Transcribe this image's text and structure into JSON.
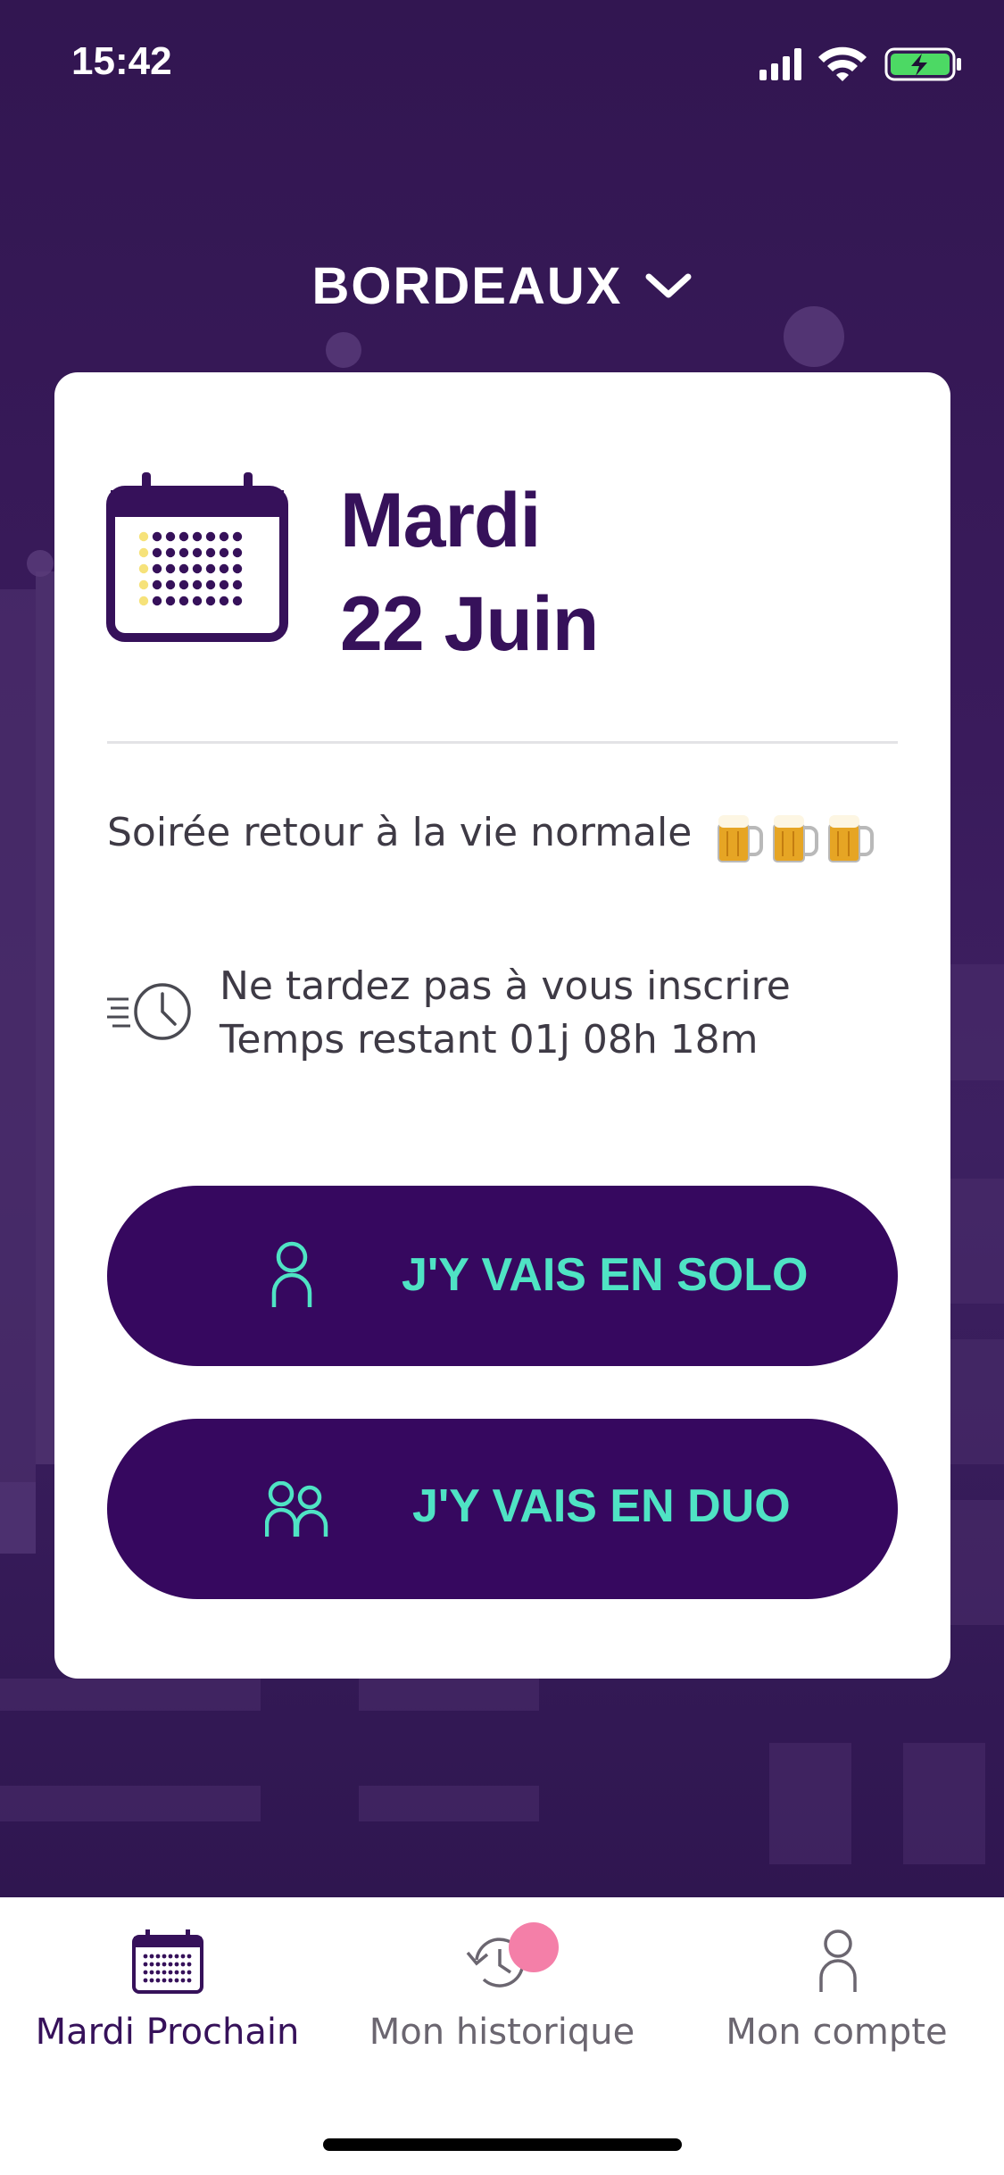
{
  "status_bar": {
    "time": "15:42"
  },
  "header": {
    "city": "BORDEAUX"
  },
  "card": {
    "day": "Mardi",
    "date": "22 Juin",
    "event_title": "Soirée retour à la vie normale",
    "event_emoji": "beer-mugs",
    "deadline_line1": "Ne tardez pas à vous inscrire",
    "deadline_line2": "Temps restant  01j 08h 18m",
    "solo_button": "J'Y VAIS EN SOLO",
    "duo_button": "J'Y VAIS EN DUO"
  },
  "nav": {
    "items": [
      {
        "label": "Mardi Prochain",
        "icon": "calendar-icon",
        "active": true
      },
      {
        "label": "Mon historique",
        "icon": "history-icon",
        "active": false,
        "badge": true
      },
      {
        "label": "Mon compte",
        "icon": "person-icon",
        "active": false
      }
    ]
  },
  "colors": {
    "primary": "#36085f",
    "accent": "#4fe3c4",
    "calendar_highlight": "#f6e27a",
    "badge": "#f47fa8",
    "background": "#321651"
  }
}
